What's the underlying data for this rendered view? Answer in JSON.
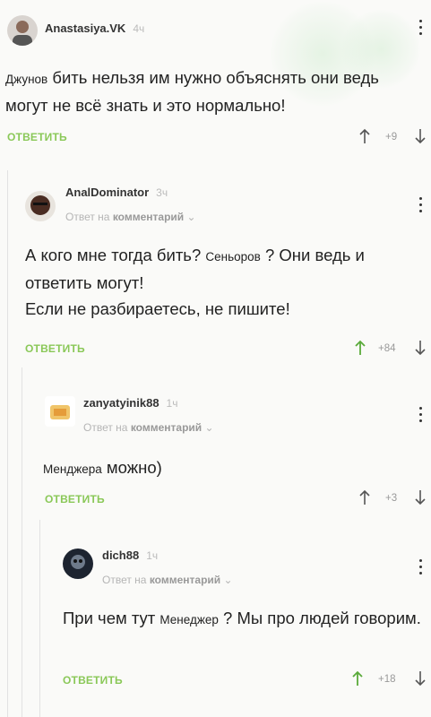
{
  "comments": [
    {
      "author": "Anastasiya.VK",
      "time": "4ч",
      "reply_to": "",
      "text_prefix_small": "Джунов",
      "text_main": " бить нельзя им нужно объяснять они ведь могут не всё знать и это нормально!",
      "reply_label": "ОТВЕТИТЬ",
      "rating": "+9"
    },
    {
      "author": "AnalDominator",
      "time": "3ч",
      "reply_to_prefix": "Ответ на",
      "reply_to_target": "комментарий",
      "text_1": "А кого мне тогда бить? ",
      "text_small": "Сеньоров",
      "text_2": "  ? Они ведь и ответить могут!",
      "text_3": "Если не разбираетесь, не пишите!",
      "reply_label": "ОТВЕТИТЬ",
      "rating": "+84"
    },
    {
      "author": "zanyatyinik88",
      "time": "1ч",
      "reply_to_prefix": "Ответ на",
      "reply_to_target": "комментарий",
      "text_small": "Менджера",
      "text_main": "  можно)",
      "reply_label": "ОТВЕТИТЬ",
      "rating": "+3"
    },
    {
      "author": "dich88",
      "time": "1ч",
      "reply_to_prefix": "Ответ на",
      "reply_to_target": "комментарий",
      "text_1": "При чем тут ",
      "text_small": "Менеджер",
      "text_2": " ? Мы про людей говорим.",
      "reply_label": "ОТВЕТИТЬ",
      "rating": "+18"
    }
  ],
  "colors": {
    "accent_green": "#8ac858",
    "up_arrow_active": "#5aaa3a",
    "muted": "#b5b5b5"
  },
  "icons": [
    "up-arrow-icon",
    "down-arrow-icon",
    "more-vertical-icon",
    "chevron-down-icon"
  ]
}
